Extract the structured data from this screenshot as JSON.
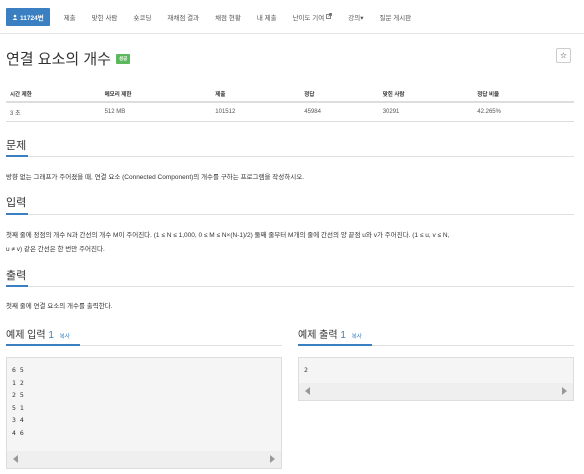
{
  "nav": {
    "active": "11724번",
    "items": [
      "제출",
      "맞힌 사람",
      "숏코딩",
      "재채점 결과",
      "채점 현황",
      "내 제출",
      "난이도 기여",
      "강의▾",
      "질문 게시판"
    ]
  },
  "problem": {
    "title": "연결 요소의 개수",
    "badge": "성공",
    "star": "☆"
  },
  "stats": {
    "headers": [
      "시간 제한",
      "메모리 제한",
      "제출",
      "정답",
      "맞힌 사람",
      "정답 비율"
    ],
    "values": [
      "3 초",
      "512 MB",
      "101512",
      "45984",
      "30291",
      "42.265%"
    ]
  },
  "sections": {
    "problem_head": "문제",
    "problem_text": "방향 없는 그래프가 주어졌을 때, 연결 요소 (Connected Component)의 개수를 구하는 프로그램을 작성하시오.",
    "input_head": "입력",
    "input_text_1": "첫째 줄에 정점의 개수 N과 간선의 개수 M이 주어진다. (1 ≤ N ≤ 1,000, 0 ≤ M ≤ N×(N-1)/2) 둘째 줄부터 M개의 줄에 간선의 양 끝점 u와 v가 주어진다. (1 ≤ u, v ≤ N,",
    "input_text_2": "u ≠ v) 같은 간선은 한 번만 주어진다.",
    "output_head": "출력",
    "output_text": "첫째 줄에 연결 요소의 개수를 출력한다."
  },
  "examples": {
    "input_title": "예제 입력",
    "input_num": "1",
    "output_title": "예제 출력",
    "output_num": "1",
    "copy": "복사",
    "input_data": "6 5\n1 2\n2 5\n5 1\n3 4\n4 6",
    "output_data": "2"
  },
  "colors": {
    "accent": "#3a7fc1",
    "success": "#5cb85c"
  }
}
